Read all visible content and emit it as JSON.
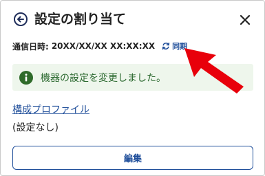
{
  "header": {
    "title": "設定の割り当て",
    "back_icon": "arrow-left-circle-icon",
    "close_icon": "close-icon"
  },
  "communication": {
    "label": "通信日時:",
    "value": "20XX/XX/XX XX:XX:XX",
    "sync_label": "同期",
    "sync_icon": "refresh-icon"
  },
  "banner": {
    "icon": "info-icon",
    "message": "機器の設定を変更しました。"
  },
  "profile": {
    "link_label": "構成プロファイル",
    "value": "(設定なし)"
  },
  "actions": {
    "edit_label": "編集"
  },
  "colors": {
    "accent": "#1f4e9a",
    "banner_bg": "#eef6ec",
    "banner_text": "#2d6a31",
    "info_icon": "#2f6b2a",
    "arrow": "#e8000b"
  }
}
